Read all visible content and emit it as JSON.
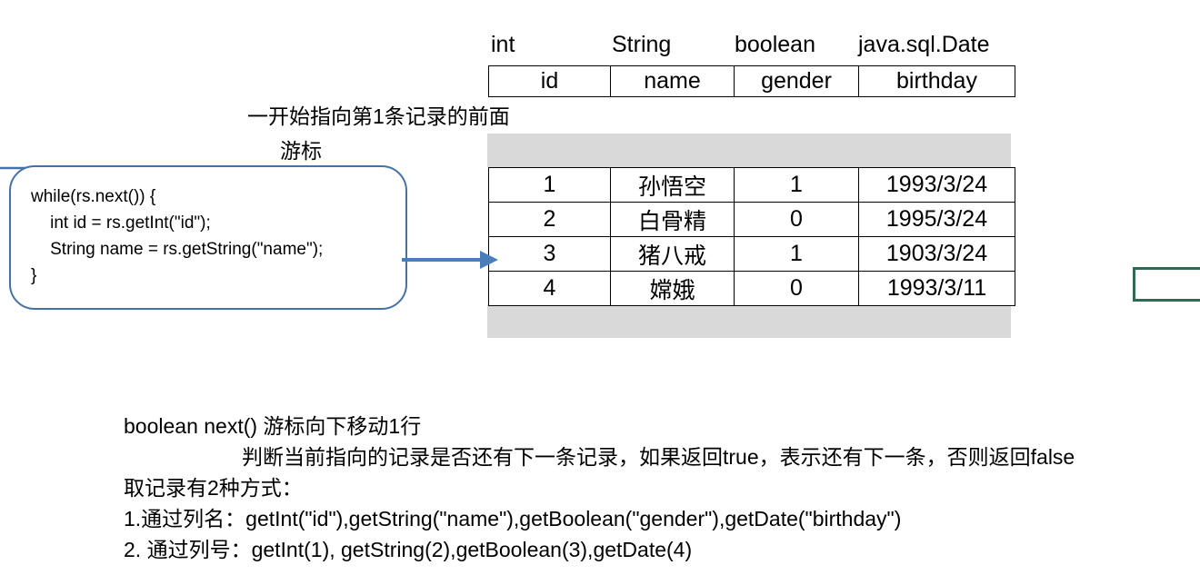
{
  "table": {
    "types": [
      "int",
      "String",
      "boolean",
      "java.sql.Date"
    ],
    "columns": [
      "id",
      "name",
      "gender",
      "birthday"
    ],
    "rows": [
      [
        "1",
        "孙悟空",
        "1",
        "1993/3/24"
      ],
      [
        "2",
        "白骨精",
        "0",
        "1995/3/24"
      ],
      [
        "3",
        "猪八戒",
        "1",
        "1903/3/24"
      ],
      [
        "4",
        "嫦娥",
        "0",
        "1993/3/11"
      ]
    ],
    "band_color": "#d9d9d9"
  },
  "annotations": {
    "cursor_note": "一开始指向第1条记录的前面",
    "cursor_label": "游标"
  },
  "code_box": {
    "accent_color": "#4472A8",
    "lines": [
      "while(rs.next()) {",
      "    int id = rs.getInt(\"id\");",
      "    String name = rs.getString(\"name\");",
      "}"
    ]
  },
  "notes": {
    "line1": "boolean next() 游标向下移动1行",
    "line2": "判断当前指向的记录是否还有下一条记录，如果返回true，表示还有下一条，否则返回false",
    "line3": "取记录有2种方式：",
    "line4": "1.通过列名：getInt(\"id\"),getString(\"name\"),getBoolean(\"gender\"),getDate(\"birthday\")",
    "line5": "2. 通过列号：getInt(1), getString(2),getBoolean(3),getDate(4)"
  },
  "shapes": {
    "arrow_color": "#4A7EBB",
    "green_box_color": "#2E6B52"
  }
}
